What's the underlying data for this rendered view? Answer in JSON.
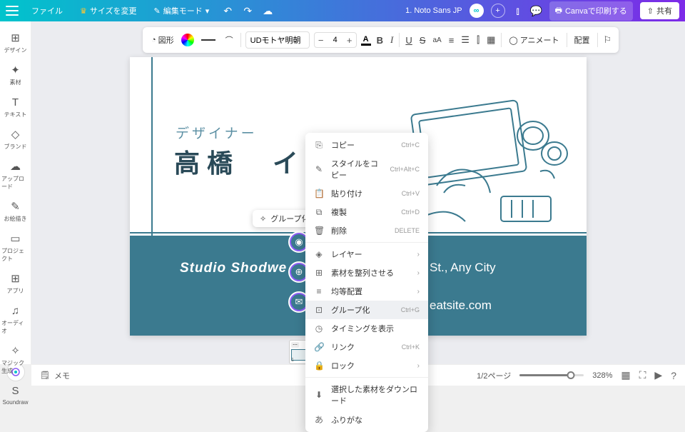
{
  "header": {
    "file": "ファイル",
    "resize": "サイズを変更",
    "edit_mode": "編集モード",
    "doc_title": "1. Noto Sans JP",
    "print": "Canvaで印刷する",
    "share": "共有"
  },
  "toolbar": {
    "shape": "図形",
    "font_name": "UDモトヤ明朝",
    "font_size": "4",
    "animate": "アニメート",
    "position": "配置"
  },
  "sidebar": {
    "items": [
      {
        "icon": "⊞",
        "label": "デザイン"
      },
      {
        "icon": "✦",
        "label": "素材"
      },
      {
        "icon": "T",
        "label": "テキスト"
      },
      {
        "icon": "◇",
        "label": "ブランド"
      },
      {
        "icon": "☁",
        "label": "アップロード"
      },
      {
        "icon": "✎",
        "label": "お絵描き"
      },
      {
        "icon": "▭",
        "label": "プロジェクト"
      },
      {
        "icon": "⊞",
        "label": "アプリ"
      },
      {
        "icon": "♫",
        "label": "オーディオ"
      },
      {
        "icon": "✧",
        "label": "マジック生成"
      },
      {
        "icon": "S",
        "label": "Soundraw"
      }
    ]
  },
  "canvas": {
    "subtitle": "デザイナー",
    "title": "高橋　イツ",
    "studio": "Studio Shodwe",
    "address": "St., Any City",
    "website": "eatsite.com"
  },
  "floating": {
    "group": "グループ化"
  },
  "context_menu": {
    "items": [
      {
        "icon": "⎘",
        "label": "コピー",
        "shortcut": "Ctrl+C"
      },
      {
        "icon": "✎",
        "label": "スタイルをコピー",
        "shortcut": "Ctrl+Alt+C"
      },
      {
        "icon": "📋",
        "label": "貼り付け",
        "shortcut": "Ctrl+V"
      },
      {
        "icon": "⧉",
        "label": "複製",
        "shortcut": "Ctrl+D"
      },
      {
        "icon": "🗑",
        "label": "削除",
        "shortcut": "DELETE"
      }
    ],
    "items2": [
      {
        "icon": "◈",
        "label": "レイヤー",
        "arrow": true
      },
      {
        "icon": "⊞",
        "label": "素材を整列させる",
        "arrow": true
      },
      {
        "icon": "≡",
        "label": "均等配置",
        "arrow": true
      },
      {
        "icon": "⊡",
        "label": "グループ化",
        "shortcut": "Ctrl+G",
        "hl": true
      },
      {
        "icon": "◷",
        "label": "タイミングを表示"
      },
      {
        "icon": "🔗",
        "label": "リンク",
        "shortcut": "Ctrl+K"
      },
      {
        "icon": "🔒",
        "label": "ロック",
        "arrow": true
      }
    ],
    "items3": [
      {
        "icon": "⬇",
        "label": "選択した素材をダウンロード"
      },
      {
        "icon": "あ",
        "label": "ふりがな"
      }
    ]
  },
  "footer": {
    "memo": "メモ",
    "page": "1/2ページ",
    "zoom": "328%"
  }
}
